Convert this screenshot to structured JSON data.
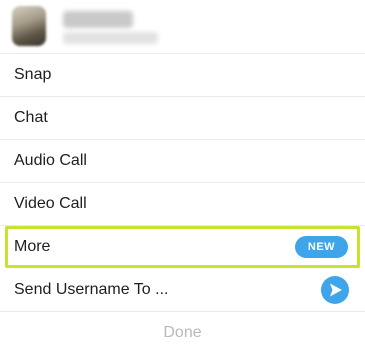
{
  "header": {
    "avatar_icon": "blurred-user-avatar"
  },
  "menu": {
    "snap": "Snap",
    "chat": "Chat",
    "audio_call": "Audio Call",
    "video_call": "Video Call",
    "more": "More",
    "more_badge": "NEW",
    "send_username": "Send Username To ...",
    "send_icon": "send-arrow-icon"
  },
  "footer": {
    "done": "Done"
  },
  "colors": {
    "highlight_border": "#c6e32f",
    "badge": "#3ea5ea",
    "send_icon": "#3ea5ea",
    "done_text": "#b9b9b9"
  }
}
